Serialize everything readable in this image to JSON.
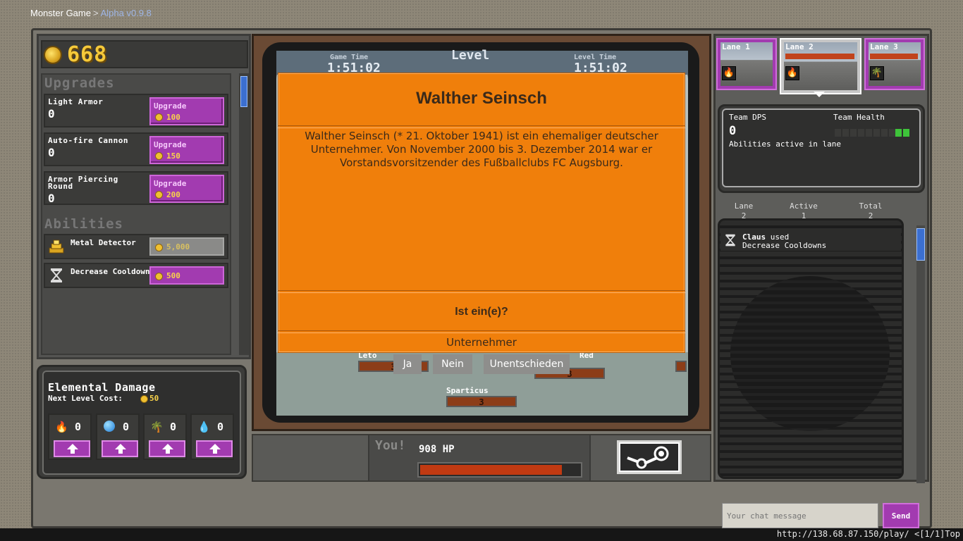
{
  "breadcrumb": {
    "app": "Monster Game",
    "separator": ">",
    "version": "Alpha v0.9.8"
  },
  "gold": {
    "amount": "668",
    "icon": "coin-icon"
  },
  "upgrades": {
    "title": "Upgrades",
    "items": [
      {
        "name": "Light Armor",
        "level": "0",
        "button": "Upgrade",
        "cost": "100"
      },
      {
        "name": "Auto-fire Cannon",
        "level": "0",
        "button": "Upgrade",
        "cost": "150"
      },
      {
        "name": "Armor Piercing Round",
        "level": "0",
        "button": "Upgrade",
        "cost": "200"
      }
    ]
  },
  "abilities": {
    "title": "Abilities",
    "items": [
      {
        "name": "Metal Detector",
        "cost": "5,000",
        "icon": "gold-pile-icon",
        "affordable": false
      },
      {
        "name": "Decrease Cooldowns",
        "cost": "500",
        "icon": "hourglass-icon",
        "affordable": true
      }
    ]
  },
  "elemental": {
    "title": "Elemental Damage",
    "next_level_label": "Next Level Cost:",
    "next_level_cost": "50",
    "elements": [
      {
        "icon": "fire-icon",
        "count": "0"
      },
      {
        "icon": "water-icon",
        "count": "0"
      },
      {
        "icon": "palm-tree-icon",
        "count": "0"
      },
      {
        "icon": "ice-icon",
        "count": "0"
      }
    ]
  },
  "screen": {
    "game_time_label": "Game Time",
    "game_time": "1:51:02",
    "level_label": "Level",
    "level_time_label": "Level Time",
    "level_time": "1:51:02",
    "enemies": [
      {
        "name": "Leto",
        "hp": "3"
      },
      {
        "name": "Red",
        "hp": "3"
      },
      {
        "name": "Sparticus",
        "hp": "3"
      }
    ]
  },
  "player": {
    "you_label": "You!",
    "hp_text": "908 HP",
    "hp_fraction": 0.89
  },
  "lanes": [
    {
      "label": "Lane 1",
      "icon": "fire-icon",
      "active": false
    },
    {
      "label": "Lane 2",
      "icon": "fire-icon",
      "active": true
    },
    {
      "label": "Lane 3",
      "icon": "palm-tree-icon",
      "active": false
    }
  ],
  "team": {
    "dps_label": "Team DPS",
    "dps_value": "0",
    "health_label": "Team Health",
    "abilities_label": "Abilities active in lane"
  },
  "lane_stats": {
    "labels": [
      "Lane",
      "Active",
      "Total"
    ],
    "values": [
      "2",
      "1",
      "2"
    ]
  },
  "log": {
    "user": "Claus",
    "verb": "used",
    "action": "Decrease Cooldowns"
  },
  "chat": {
    "placeholder": "Your chat message",
    "send": "Send"
  },
  "overlay": {
    "title": "Walther Seinsch",
    "text": "Walther Seinsch (* 21. Oktober 1941) ist ein ehemaliger deutscher Unternehmer. Von November 2000 bis 3. Dezember 2014 war er Vorstandsvorsitzender des Fußballclubs FC Augsburg.",
    "question": "Ist ein(e)?",
    "answer": "Unternehmer",
    "buttons": [
      "Ja",
      "Nein",
      "Unentschieden"
    ]
  },
  "statusbar": {
    "text": "http://138.68.87.150/play/ <[1/1]Top"
  },
  "colors": {
    "accent": "#a23bb0",
    "overlay": "#f07f0b",
    "gold": "#f5c93a",
    "hp": "#c13a12"
  }
}
